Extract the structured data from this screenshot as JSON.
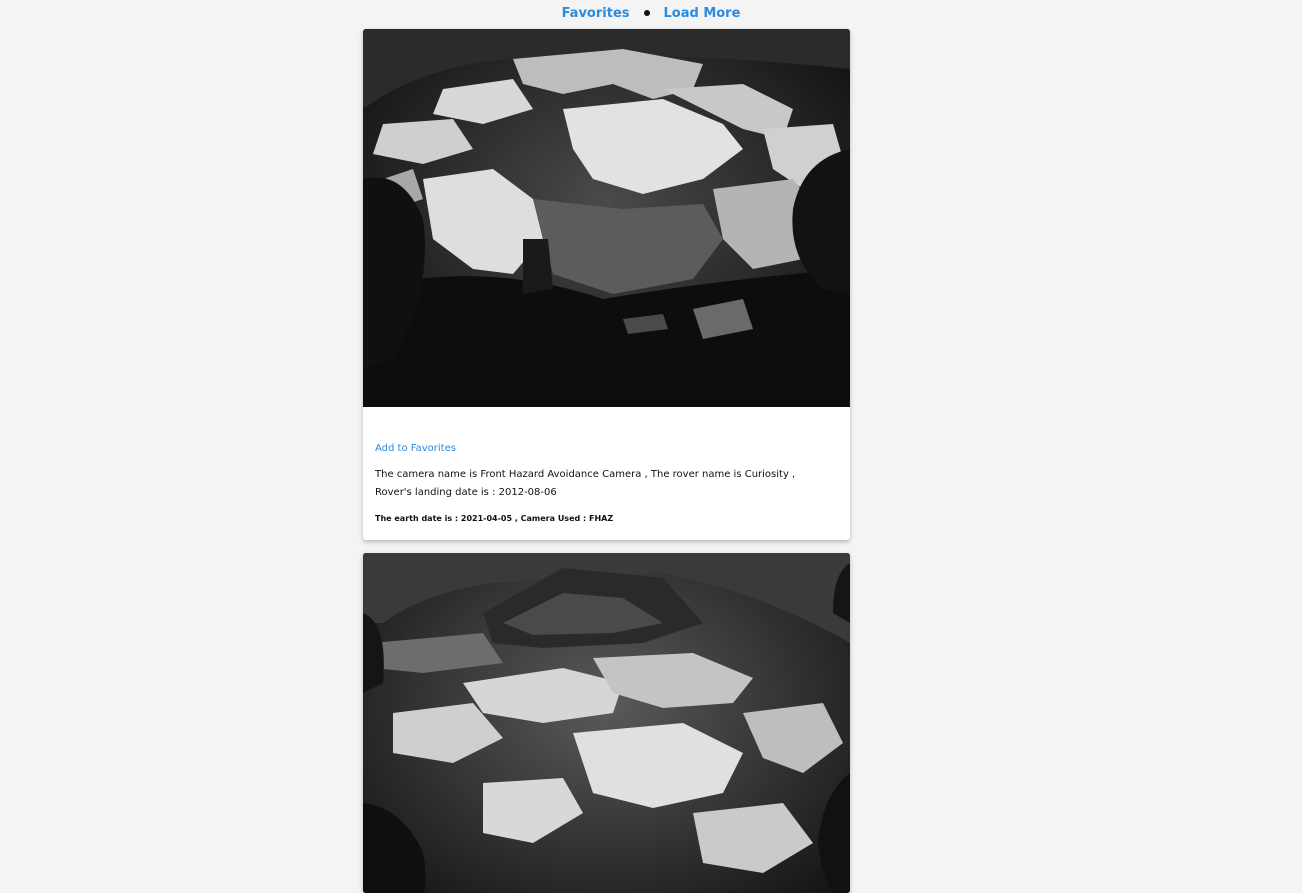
{
  "nav": {
    "favorites_label": "Favorites",
    "load_more_label": "Load More"
  },
  "cards": [
    {
      "add_favorites_label": "Add to Favorites",
      "description_line1": "The camera name is Front Hazard Avoidance Camera , The rover name is Curiosity ,",
      "description_line2": "Rover's landing date is : 2012-08-06",
      "earth_date_text": "The earth date is : 2021-04-05 , Camera Used : FHAZ",
      "image_icon": "mars-rover-photo-icon"
    },
    {
      "image_icon": "mars-rover-photo-icon"
    }
  ],
  "colors": {
    "background": "#f4f4f4",
    "link": "#2a8bde",
    "card": "#ffffff"
  }
}
